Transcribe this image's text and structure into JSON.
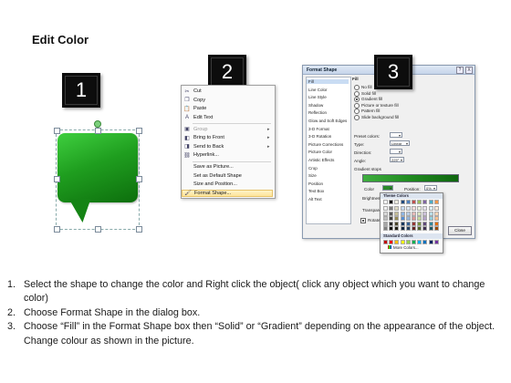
{
  "title": "Edit Color",
  "badges": [
    "1",
    "2",
    "3"
  ],
  "colors": {
    "green_light": "#3fcf3f",
    "green_dark": "#0d6e0d",
    "badge_bg": "#0d0d0d",
    "highlight": "#fde49a"
  },
  "context_menu": {
    "items": [
      {
        "icon": "scissors-icon",
        "glyph": "✂",
        "label": "Cut",
        "disabled": false,
        "submenu": false
      },
      {
        "icon": "copy-icon",
        "glyph": "❐",
        "label": "Copy",
        "disabled": false,
        "submenu": false
      },
      {
        "icon": "paste-icon",
        "glyph": "📋",
        "label": "Paste",
        "disabled": false,
        "submenu": false
      },
      {
        "icon": "edit-text-icon",
        "glyph": "A",
        "label": "Edit Text",
        "disabled": false,
        "submenu": false
      },
      {
        "icon": "group-icon",
        "glyph": "▣",
        "label": "Group",
        "disabled": true,
        "submenu": true
      },
      {
        "icon": "bring-front-icon",
        "glyph": "◧",
        "label": "Bring to Front",
        "disabled": false,
        "submenu": true
      },
      {
        "icon": "send-back-icon",
        "glyph": "◨",
        "label": "Send to Back",
        "disabled": false,
        "submenu": true
      },
      {
        "icon": "hyperlink-icon",
        "glyph": "⛓",
        "label": "Hyperlink...",
        "disabled": false,
        "submenu": false
      },
      {
        "icon": "save-picture-icon",
        "glyph": "",
        "label": "Save as Picture...",
        "disabled": false,
        "submenu": false
      },
      {
        "icon": "default-shape-icon",
        "glyph": "",
        "label": "Set as Default Shape",
        "disabled": false,
        "submenu": false
      },
      {
        "icon": "size-position-icon",
        "glyph": "",
        "label": "Size and Position...",
        "disabled": false,
        "submenu": false
      },
      {
        "icon": "format-shape-icon",
        "glyph": "🖌",
        "label": "Format Shape...",
        "disabled": false,
        "submenu": false,
        "highlighted": true
      }
    ]
  },
  "dialog": {
    "title": "Format Shape",
    "title_buttons": [
      "?",
      "X"
    ],
    "categories": [
      "Fill",
      "Line Color",
      "Line Style",
      "Shadow",
      "Reflection",
      "Glow and Soft Edges",
      "3-D Format",
      "3-D Rotation",
      "Picture Corrections",
      "Picture Color",
      "Artistic Effects",
      "Crop",
      "Size",
      "Position",
      "Text Box",
      "Alt Text"
    ],
    "fill_heading": "Fill",
    "fill_options": [
      {
        "label": "No fill",
        "checked": false
      },
      {
        "label": "Solid fill",
        "checked": false
      },
      {
        "label": "Gradient fill",
        "checked": true
      },
      {
        "label": "Picture or texture fill",
        "checked": false
      },
      {
        "label": "Pattern fill",
        "checked": false
      },
      {
        "label": "Slide background fill",
        "checked": false
      }
    ],
    "preset_colors_label": "Preset colors:",
    "type_label": "Type:",
    "type_value": "Linear",
    "direction_label": "Direction:",
    "angle_label": "Angle:",
    "angle_value": "225°",
    "gradient_stops_label": "Gradient stops",
    "color_label": "Color",
    "position_label": "Position:",
    "position_value": "0%",
    "brightness_label": "Brightness",
    "transparency_label": "Transpare",
    "rotate_label": "Rotate",
    "close_label": "Close"
  },
  "palette": {
    "theme_header": "Theme Colors",
    "standard_header": "Standard Colors",
    "more_label": "More Colors...",
    "theme_top": [
      "#ffffff",
      "#000000",
      "#eeece1",
      "#1f497d",
      "#4f81bd",
      "#c0504d",
      "#9bbb59",
      "#8064a2",
      "#4bacc6",
      "#f79646"
    ],
    "theme_columns": [
      [
        "#f2f2f2",
        "#d9d9d9",
        "#bfbfbf",
        "#a6a6a6",
        "#808080"
      ],
      [
        "#7f7f7f",
        "#595959",
        "#404040",
        "#262626",
        "#0d0d0d"
      ],
      [
        "#ddd9c3",
        "#c4bd97",
        "#948a54",
        "#4a452a",
        "#1d1b10"
      ],
      [
        "#c6d9f0",
        "#8db3e2",
        "#548dd4",
        "#17365d",
        "#0f243e"
      ],
      [
        "#dbe5f1",
        "#b8cce4",
        "#95b3d7",
        "#366092",
        "#244061"
      ],
      [
        "#f2dcdb",
        "#e5b9b7",
        "#d99694",
        "#953734",
        "#632423"
      ],
      [
        "#ebf1dd",
        "#d7e3bc",
        "#c3d69b",
        "#76923c",
        "#4f6128"
      ],
      [
        "#e5e0ec",
        "#ccc1d9",
        "#b2a2c7",
        "#5f497a",
        "#3f3151"
      ],
      [
        "#dbeef3",
        "#b7dde8",
        "#92cddc",
        "#31859b",
        "#205867"
      ],
      [
        "#fdeada",
        "#fbd5b5",
        "#fac08f",
        "#e36c09",
        "#974806"
      ]
    ],
    "standard": [
      "#c00000",
      "#ff0000",
      "#ffc000",
      "#ffff00",
      "#92d050",
      "#00b050",
      "#00b0f0",
      "#0070c0",
      "#002060",
      "#7030a0"
    ]
  },
  "steps": [
    {
      "num": "1.",
      "text": "Select the shape to change the color and Right click the object( click any object which you want to change color)"
    },
    {
      "num": "2.",
      "text": "Choose Format Shape in the dialog box."
    },
    {
      "num": "3.",
      "text": "Choose “Fill” in the Format Shape box then “Solid” or “Gradient” depending on the appearance of the object. Change colour as shown in the picture."
    }
  ]
}
